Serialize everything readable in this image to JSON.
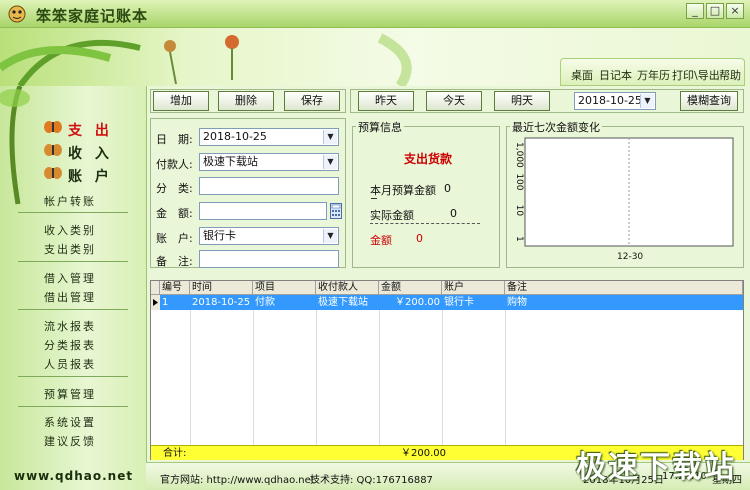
{
  "app": {
    "title": "笨笨家庭记账本"
  },
  "window_controls": {
    "minimize": "_",
    "maximize": "□",
    "close": "×"
  },
  "topnav": [
    "桌面",
    "日记本",
    "万年历",
    "打印\\导出",
    "帮助"
  ],
  "sidebar": {
    "main_items": [
      "支 出",
      "收 入",
      "账 户"
    ],
    "sub_items": [
      "帐户转账",
      "收入类别",
      "支出类别",
      "借入管理",
      "借出管理",
      "流水报表",
      "分类报表",
      "人员报表",
      "预算管理",
      "系统设置",
      "建议反馈"
    ],
    "site_url": "www.qdhao.net"
  },
  "toolbar": {
    "add": "增加",
    "delete": "删除",
    "save": "保存",
    "yesterday": "昨天",
    "today": "今天",
    "tomorrow": "明天",
    "date": "2018-10-25",
    "fuzzy_search": "模糊查询"
  },
  "form": {
    "date_label": "日　期:",
    "date_value": "2018-10-25",
    "payee_label": "付款人:",
    "payee_value": "极速下载站",
    "category_label": "分　类:",
    "category_value": "",
    "amount_label": "金　额:",
    "amount_value": "",
    "account_label": "账　户:",
    "account_value": "银行卡",
    "note_label": "备　注:",
    "note_value": ""
  },
  "budget": {
    "title": "预算信息",
    "heading": "支出货款",
    "month_budget_label": "本月预算金额",
    "month_budget_value": "0",
    "actual_label": "实际金额",
    "actual_value": "0",
    "amount_label": "金额",
    "amount_value": "0"
  },
  "chart_data": {
    "type": "line",
    "title": "最近七次金额变化",
    "categories": [
      "12-30"
    ],
    "y_tick_labels": [
      "1,000",
      "100",
      "10",
      "1"
    ],
    "scale": "log",
    "series": [
      {
        "values": []
      }
    ],
    "grid": true
  },
  "grid": {
    "headers": [
      "编号",
      "时间",
      "项目",
      "收付款人",
      "金额",
      "账户",
      "备注"
    ],
    "rows": [
      [
        "1",
        "2018-10-25",
        "付款",
        "极速下载站",
        "￥200.00",
        "银行卡",
        "购物"
      ]
    ],
    "total_label": "合计:",
    "total_value": "￥200.00"
  },
  "status": {
    "website": "官方网站: http://www.qdhao.net",
    "support": "技术支持: QQ:176716887",
    "date": "2018年10月25日",
    "time": "17:25:10",
    "weekday": "星期四"
  },
  "watermark": "极速下载站",
  "colors": {
    "accent": "#3399ff",
    "selected_row": "#3399ff",
    "totals_row": "#ffff33",
    "expense_red": "#cc0000"
  },
  "icons": [
    "app-logo-icon",
    "butterfly-icon",
    "calendar-icon",
    "dropdown-arrow-icon",
    "row-pointer-icon"
  ]
}
